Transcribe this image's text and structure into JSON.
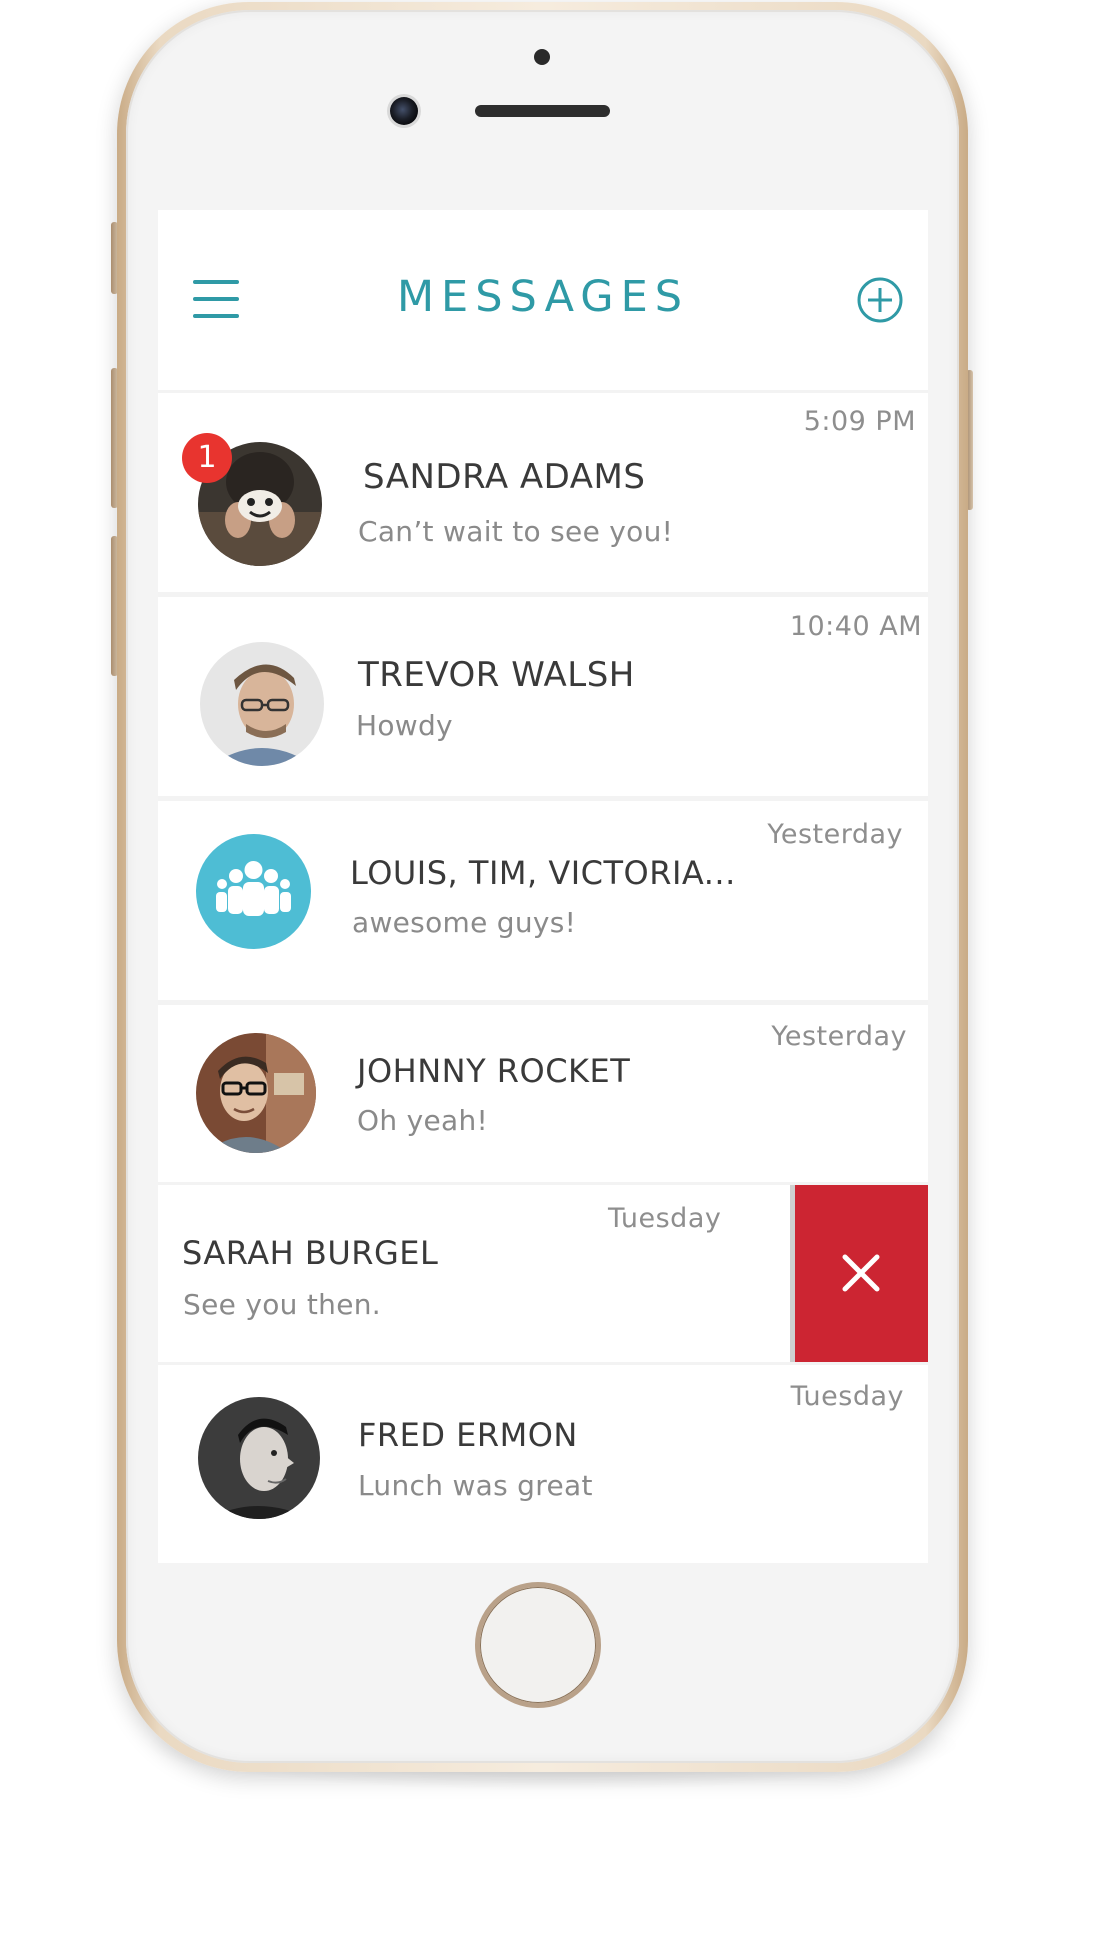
{
  "header": {
    "title": "MESSAGES",
    "menu_icon": "hamburger-menu-icon",
    "add_icon": "plus-circle-icon",
    "accent_color": "#2f9aa6"
  },
  "conversations": [
    {
      "name": "SANDRA ADAMS",
      "preview": "Can’t wait to see you!",
      "time": "5:09 PM",
      "unread_count": "1",
      "avatar": "photo-avatar"
    },
    {
      "name": "TREVOR WALSH",
      "preview": "Howdy",
      "time": "10:40 AM",
      "avatar": "photo-avatar"
    },
    {
      "name": "LOUIS, TIM, VICTORIA...",
      "preview": "awesome guys!",
      "time": "Yesterday",
      "avatar": "group-icon"
    },
    {
      "name": "JOHNNY ROCKET",
      "preview": "Oh yeah!",
      "time": "Yesterday",
      "avatar": "photo-avatar"
    },
    {
      "name": "SARAH BURGEL",
      "preview": "See you then.",
      "time": "Tuesday",
      "swiped": true,
      "action_icon": "close-x-icon",
      "action_color": "#cc2532"
    },
    {
      "name": "FRED ERMON",
      "preview": "Lunch was great",
      "time": "Tuesday",
      "avatar": "photo-avatar"
    }
  ],
  "badge_color": "#e8342f"
}
